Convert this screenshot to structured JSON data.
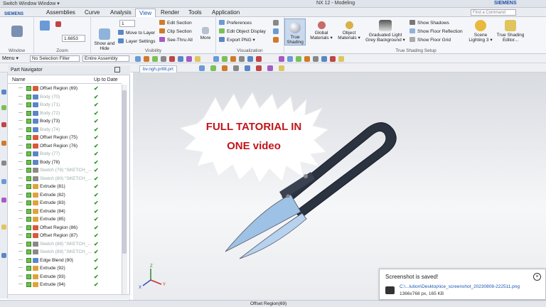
{
  "titlebar": {
    "quick_access": "Switch Window   Window ▾",
    "title": "NX 12 - Modeling",
    "brand": "SIEMENS"
  },
  "menu": {
    "tabs": [
      "Assemblies",
      "Curve",
      "Analysis",
      "View",
      "Render",
      "Tools",
      "Application"
    ],
    "active": "View",
    "search_placeholder": "Find a Command"
  },
  "logo": {
    "line1": "SIEMENS",
    "line2": "NX"
  },
  "ribbon": {
    "window_label": "Window",
    "zoom": {
      "value": "1.6853",
      "group_label": "Zoom"
    },
    "visibility": {
      "layer_value": "1",
      "show_hide": "Show and Hide",
      "move_to_layer": "Move to Layer",
      "layer_settings": "Layer Settings",
      "edit_section": "Edit Section",
      "clip_section": "Clip Section",
      "see_thru_all": "See-Thru All",
      "more": "More",
      "group_label": "Visibility"
    },
    "visualization": {
      "preferences": "Preferences",
      "edit_object_display": "Edit Object Display",
      "export_png": "Export PNG ▾",
      "group_label": "Visualization"
    },
    "true_shading": {
      "true_shading": "True Shading",
      "global_materials": "Global Materials ▾",
      "object_materials": "Object Materials ▾",
      "graduated_light": "Graduated Light Grey Background ▾",
      "show_shadows": "Show Shadows",
      "show_floor_reflection": "Show Floor Reflection",
      "show_floor_grid": "Show Floor Grid",
      "scene_lighting": "Scene Lighting 3 ▾",
      "editor": "True Shading Editor...",
      "group_label": "True Shading Setup"
    }
  },
  "toolbar": {
    "menu": "Menu ▾",
    "selection_filter": "No Selection Filter",
    "scope": "Entire Assembly"
  },
  "navigator": {
    "title": "Part Navigator",
    "col_name": "Name",
    "col_up": "Up to Date",
    "rows": [
      {
        "label": "Offset Region (69)",
        "dim": false
      },
      {
        "label": "Body (70)",
        "dim": true
      },
      {
        "label": "Body (71)",
        "dim": true
      },
      {
        "label": "Body (72)",
        "dim": true
      },
      {
        "label": "Body (73)",
        "dim": false
      },
      {
        "label": "Body (74)",
        "dim": true
      },
      {
        "label": "Offset Region (75)",
        "dim": false
      },
      {
        "label": "Offset Region (76)",
        "dim": false
      },
      {
        "label": "Body (77)",
        "dim": true
      },
      {
        "label": "Body (78)",
        "dim": false
      },
      {
        "label": "Sketch (79) \"SKETCH_...",
        "dim": true
      },
      {
        "label": "Sketch (80) \"SKETCH_...",
        "dim": true
      },
      {
        "label": "Extrude (81)",
        "dim": false
      },
      {
        "label": "Extrude (82)",
        "dim": false
      },
      {
        "label": "Extrude (83)",
        "dim": false
      },
      {
        "label": "Extrude (84)",
        "dim": false
      },
      {
        "label": "Extrude (85)",
        "dim": false
      },
      {
        "label": "Offset Region (86)",
        "dim": false
      },
      {
        "label": "Offset Region (87)",
        "dim": false
      },
      {
        "label": "Sketch (88) \"SKETCH_...",
        "dim": true
      },
      {
        "label": "Sketch (89) \"SKETCH_...",
        "dim": true
      },
      {
        "label": "Edge Blend (90)",
        "dim": false
      },
      {
        "label": "Extrude (92)",
        "dim": false
      },
      {
        "label": "Extrude (93)",
        "dim": false
      },
      {
        "label": "Extrude (94)",
        "dim": false
      }
    ]
  },
  "graphics": {
    "tab": "bv.ngh.prttlt.prt",
    "banner_line1": "FULL TATORIAL IN",
    "banner_line2": "ONE video",
    "axis_x": "X",
    "axis_y": "Y",
    "axis_z": "Z"
  },
  "status": {
    "text": "Offset Region(69)"
  },
  "toast": {
    "title": "Screenshot is saved!",
    "path": "C:\\...lution\\Desktop\\ice_screenshot_20230808-222511.png",
    "size": "1366x768 px, 165 KB"
  },
  "colors": {
    "accent": "#1a57b0",
    "check": "#2a9a2a",
    "model_blade": "#9ec2e6",
    "model_handle": "#2b3240",
    "banner_text": "#c0151b"
  }
}
